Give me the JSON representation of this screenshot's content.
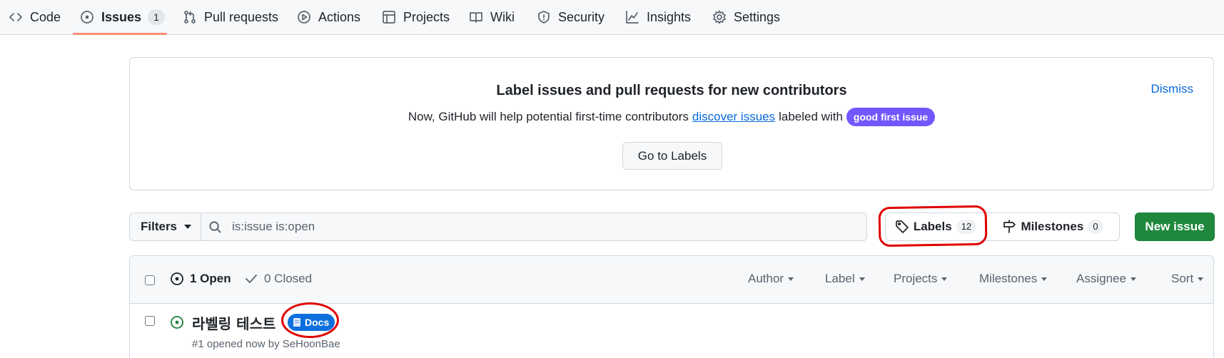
{
  "repo_nav": {
    "items": [
      {
        "label": "Code",
        "icon": "code-icon"
      },
      {
        "label": "Issues",
        "icon": "issue-opened-icon",
        "count": "1",
        "selected": true
      },
      {
        "label": "Pull requests",
        "icon": "git-pull-request-icon"
      },
      {
        "label": "Actions",
        "icon": "play-icon"
      },
      {
        "label": "Projects",
        "icon": "table-icon"
      },
      {
        "label": "Wiki",
        "icon": "book-icon"
      },
      {
        "label": "Security",
        "icon": "shield-icon"
      },
      {
        "label": "Insights",
        "icon": "graph-icon"
      },
      {
        "label": "Settings",
        "icon": "gear-icon"
      }
    ]
  },
  "banner": {
    "title": "Label issues and pull requests for new contributors",
    "text_before": "Now, GitHub will help potential first-time contributors",
    "link_text": "discover issues",
    "text_after": "labeled with",
    "label": "good first issue",
    "label_color": "#7057ff",
    "dismiss": "Dismiss",
    "button": "Go to Labels"
  },
  "toolbar": {
    "filters": "Filters",
    "search_placeholder": "is:issue is:open",
    "labels": "Labels",
    "labels_count": "12",
    "milestones": "Milestones",
    "milestones_count": "0",
    "new_issue": "New issue"
  },
  "list": {
    "open_label": "1 Open",
    "closed_label": "0 Closed",
    "sort_menus": [
      "Author",
      "Label",
      "Projects",
      "Milestones",
      "Assignee",
      "Sort"
    ],
    "issues": [
      {
        "title": "라벨링 테스트",
        "label": "Docs",
        "label_color": "#0d6fde",
        "meta_prefix": "#1 opened now by",
        "author": "SeHoonBae"
      }
    ]
  },
  "colors": {
    "accent_underline": "#fd8c73",
    "primary_button": "#1f883d",
    "link": "#0969da",
    "annotation": "#e00000"
  }
}
